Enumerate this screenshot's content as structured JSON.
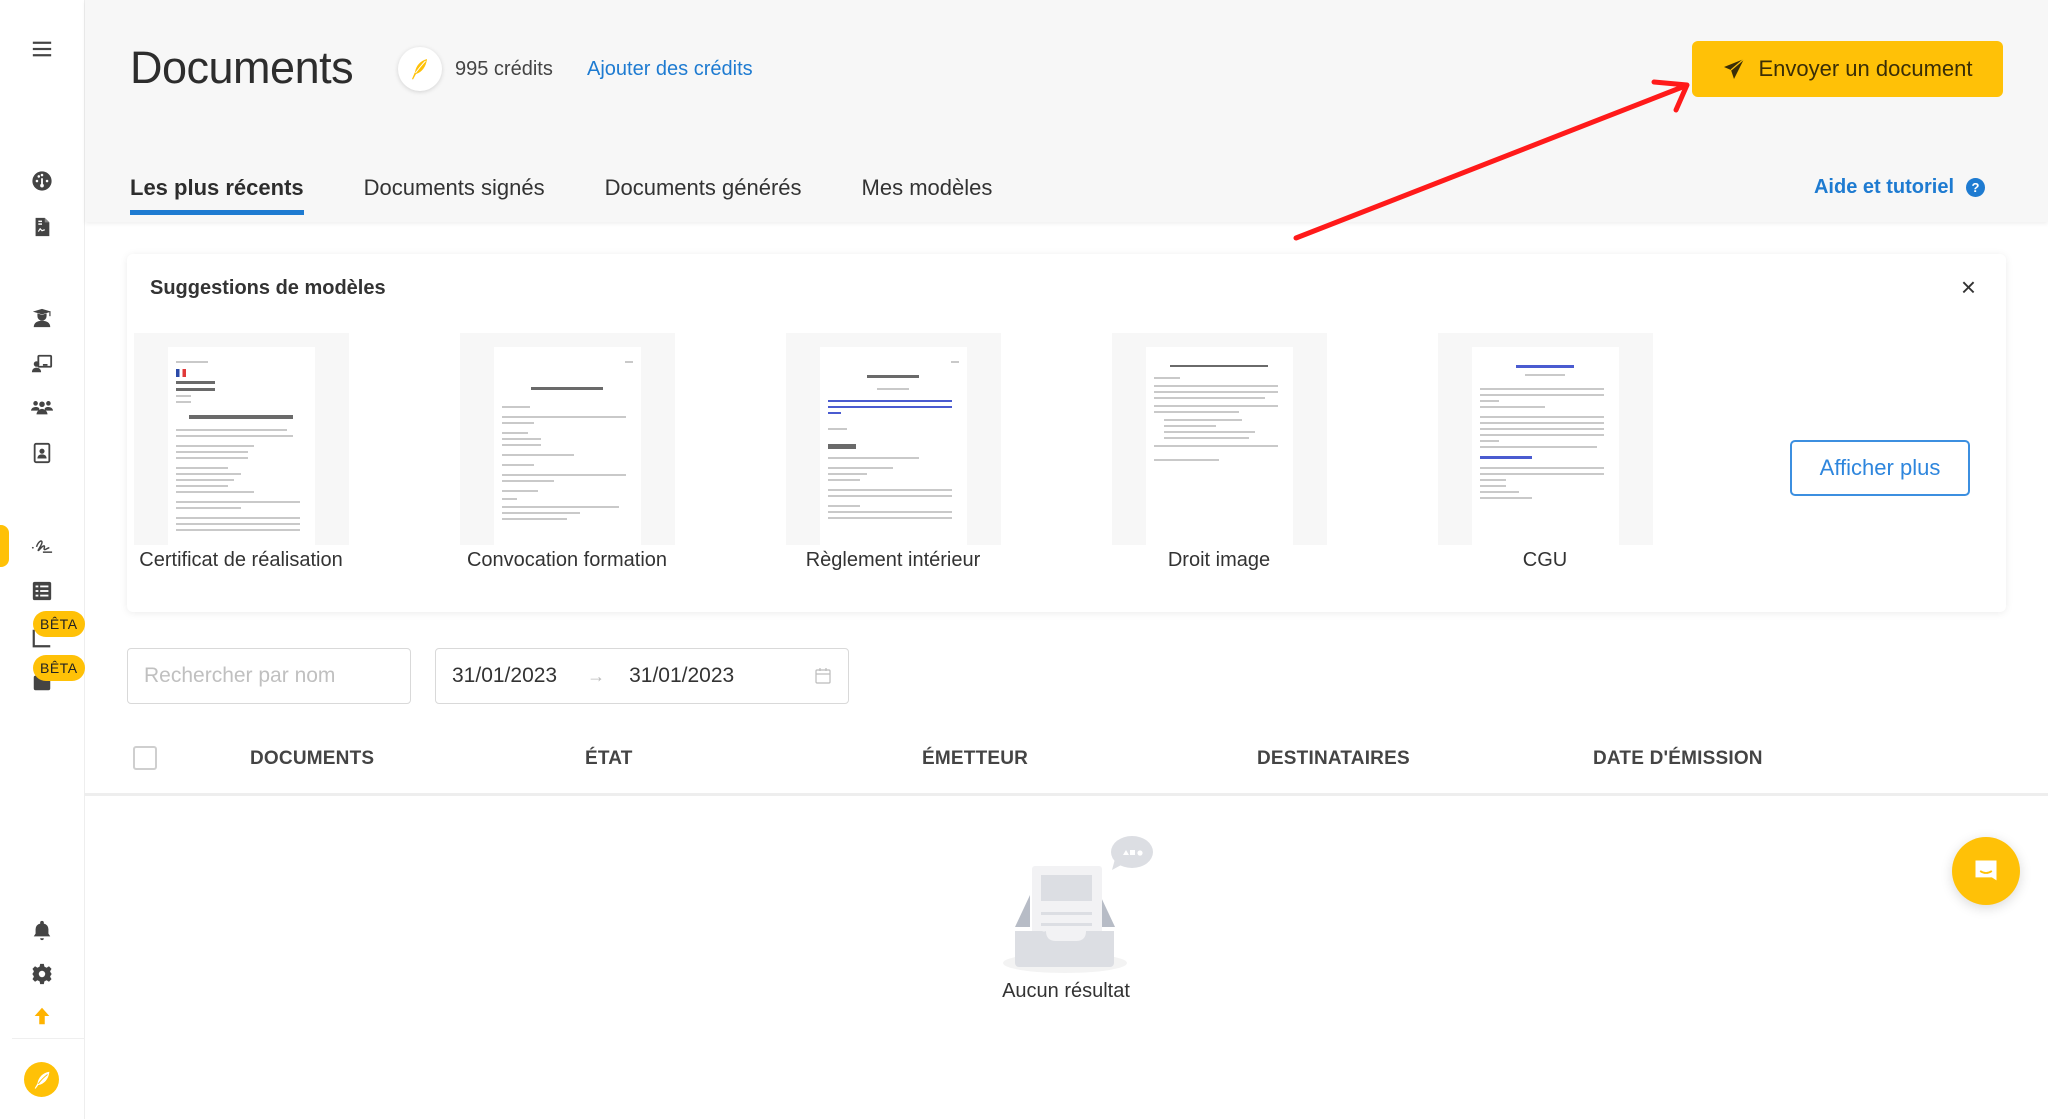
{
  "sidebar": {
    "menu_icon": "hamburger-menu-icon",
    "items": [
      {
        "name": "dashboard",
        "icon": "gauge-icon"
      },
      {
        "name": "documents-signature",
        "icon": "file-signature-icon"
      },
      {
        "name": "learners",
        "icon": "graduation-cap-icon"
      },
      {
        "name": "trainers",
        "icon": "teacher-board-icon"
      },
      {
        "name": "groups",
        "icon": "users-icon"
      },
      {
        "name": "contacts",
        "icon": "id-badge-icon"
      },
      {
        "name": "signature",
        "icon": "signature-icon",
        "active": true
      },
      {
        "name": "checklist",
        "icon": "list-check-icon"
      },
      {
        "name": "statistics",
        "icon": "chart-icon",
        "badge": "BÊTA"
      },
      {
        "name": "calendar",
        "icon": "calendar-icon",
        "badge": "BÊTA"
      }
    ],
    "bottom": [
      {
        "name": "notifications",
        "icon": "bell-icon"
      },
      {
        "name": "settings",
        "icon": "gear-icon"
      },
      {
        "name": "upgrade",
        "icon": "arrow-up-icon"
      }
    ],
    "avatar_icon": "feather-icon"
  },
  "header": {
    "title": "Documents",
    "credits": "995 crédits",
    "add_credits": "Ajouter des crédits",
    "send_button": "Envoyer un document",
    "help_link": "Aide et tutoriel",
    "help_icon_glyph": "?"
  },
  "tabs": [
    {
      "label": "Les plus récents",
      "active": true
    },
    {
      "label": "Documents signés",
      "active": false
    },
    {
      "label": "Documents générés",
      "active": false
    },
    {
      "label": "Mes modèles",
      "active": false
    }
  ],
  "suggestions": {
    "title": "Suggestions de modèles",
    "close_glyph": "×",
    "templates": [
      {
        "label": "Certificat de réalisation"
      },
      {
        "label": "Convocation formation"
      },
      {
        "label": "Règlement intérieur"
      },
      {
        "label": "Droit image"
      },
      {
        "label": "CGU"
      }
    ],
    "more_button": "Afficher plus"
  },
  "filters": {
    "search_placeholder": "Rechercher par nom",
    "search_value": "",
    "date_from": "31/01/2023",
    "date_to": "31/01/2023",
    "date_separator": "→"
  },
  "table": {
    "columns": [
      "DOCUMENTS",
      "ÉTAT",
      "ÉMETTEUR",
      "DESTINATAIRES",
      "DATE D'ÉMISSION"
    ],
    "rows": [],
    "empty_text": "Aucun résultat"
  },
  "colors": {
    "accent": "#ffc107",
    "link": "#1e7bd1",
    "annotation_arrow": "#ff1a1a"
  }
}
